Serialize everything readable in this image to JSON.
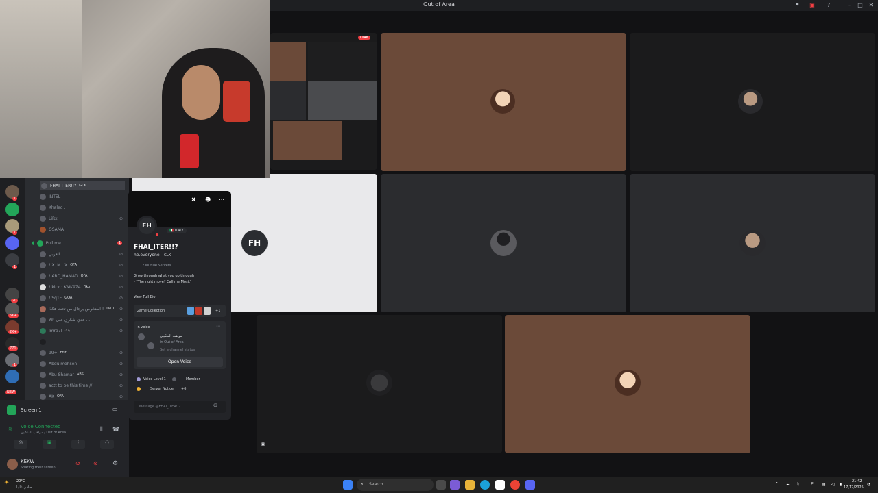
{
  "window": {
    "title": "Out of Area",
    "live_badge": "LIVE"
  },
  "members": [
    {
      "name": "FHAI_ITER!!?",
      "tag": "GLX"
    },
    {
      "name": "INTEL",
      "tag": ""
    },
    {
      "name": "Khaled .",
      "tag": ""
    },
    {
      "name": "LiRx",
      "tag": ""
    },
    {
      "name": "OSAMA",
      "tag": ""
    },
    {
      "name": "Pull me",
      "tag": ""
    },
    {
      "name": "العربي !",
      "tag": ""
    },
    {
      "name": "! X .M . X",
      "tag": "OFA"
    },
    {
      "name": "! ABD_HAMAD",
      "tag": "OFA"
    },
    {
      "name": "! kick : KMK974",
      "tag": "Fiko"
    },
    {
      "name": "! Sq1F",
      "tag": "GOAT"
    },
    {
      "name": "استخرص يرجال من تحت هكذا !",
      "tag": "LVL1"
    },
    {
      "name": "عدي شكري على الالا ...!",
      "tag": ""
    },
    {
      "name": "Imra7l",
      "tag": "بدك"
    },
    {
      "name": "- ",
      "tag": ""
    },
    {
      "name": "99+",
      "tag": "Ffst"
    },
    {
      "name": "Abdulmohsen",
      "tag": ""
    },
    {
      "name": "Abu Shamar",
      "tag": "ABS"
    },
    {
      "name": "actt to be this time //",
      "tag": ""
    },
    {
      "name": "AK",
      "tag": "OFA"
    }
  ],
  "server_badges": [
    "1",
    "1",
    "1",
    "20",
    "5K+",
    "2K+",
    "771",
    "1",
    "NEW"
  ],
  "panel": {
    "screen_label": "Screen 1",
    "voice_status": "Voice Connected",
    "voice_channel": "مواهب المتكيين / Out of Area",
    "username": "KEKW",
    "user_status": "Sharing their screen"
  },
  "profile": {
    "country_badge": "ITALY",
    "display_name": "FHAI_ITER!!?",
    "username": "he.everyone",
    "tag": "GLX",
    "mutual_servers": "2 Mutual Servers",
    "bio_line1": "Grow through what you go through",
    "bio_line2": "- \"The right move? Call me Most.\"",
    "view_bio": "View Full Bio",
    "game_collection": "Game Collection",
    "game_more": "+1",
    "in_voice_label": "In voice",
    "voice_channel_name": "مواهب المتكيين",
    "voice_server": "in Out of Area",
    "channel_status": "Set a channel status",
    "open_voice": "Open Voice",
    "role1": "Voice Level 1",
    "role2": "Member",
    "role3": "Server Notice",
    "roles_more": "+6",
    "message_placeholder": "Message @FHAI_ITER!!?"
  },
  "taskbar": {
    "weather_temp": "20°C",
    "weather_desc": "صافي غالبا",
    "search_placeholder": "Search",
    "lang": "E",
    "time": "21:42",
    "date": "17/12/2025"
  },
  "colors": {
    "discord_green": "#23a559",
    "red": "#f23f43",
    "brown_tile": "#6b4a39",
    "blurple": "#5865f2"
  }
}
